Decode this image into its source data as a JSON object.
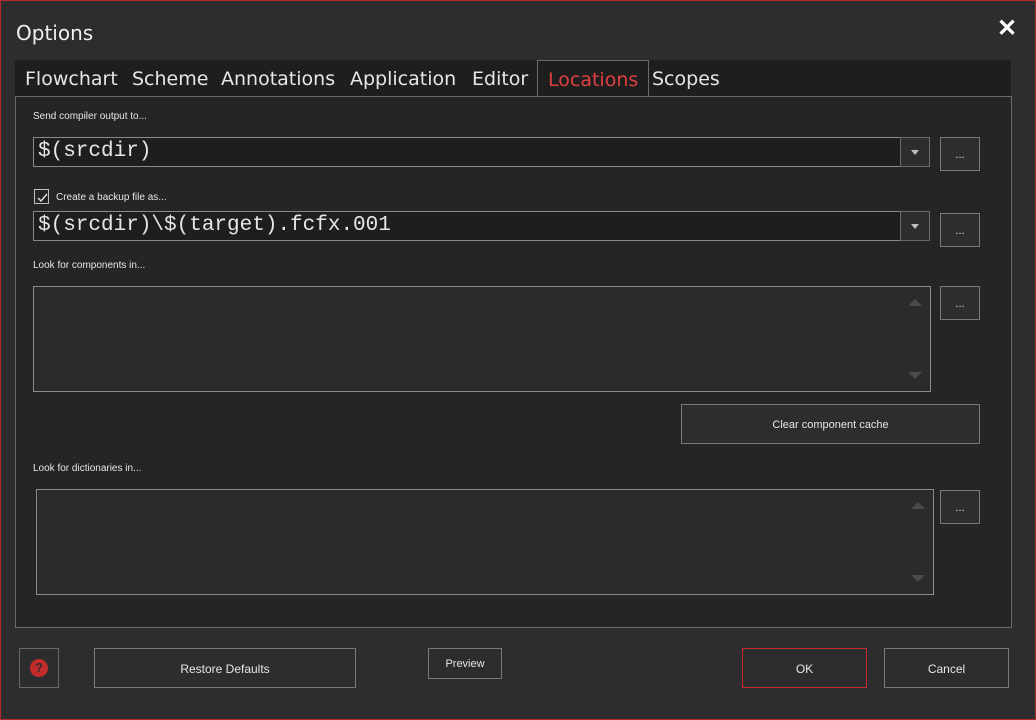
{
  "window": {
    "title": "Options",
    "close_glyph": "✕"
  },
  "tabs": [
    {
      "label": "Flowchart",
      "active": false
    },
    {
      "label": "Scheme",
      "active": false
    },
    {
      "label": "Annotations",
      "active": false
    },
    {
      "label": "Application",
      "active": false
    },
    {
      "label": "Editor",
      "active": false
    },
    {
      "label": "Locations",
      "active": true
    },
    {
      "label": "Scopes",
      "active": false
    }
  ],
  "locations": {
    "compiler_output_label": "Send compiler output to...",
    "compiler_output_value": "$(srcdir)",
    "backup_label": "Create a backup file as...",
    "backup_checked": true,
    "backup_value": "$(srcdir)\\$(target).fcfx.001",
    "components_label": "Look for components in...",
    "clear_cache_label": "Clear component cache",
    "dictionaries_label": "Look for dictionaries in...",
    "browse_label": "..."
  },
  "footer": {
    "help_glyph": "?",
    "restore_label": "Restore Defaults",
    "preview_label": "Preview",
    "ok_label": "OK",
    "cancel_label": "Cancel"
  },
  "colors": {
    "accent_red": "#e04040",
    "window_border": "#b22a2a",
    "background": "#2d2d30"
  }
}
